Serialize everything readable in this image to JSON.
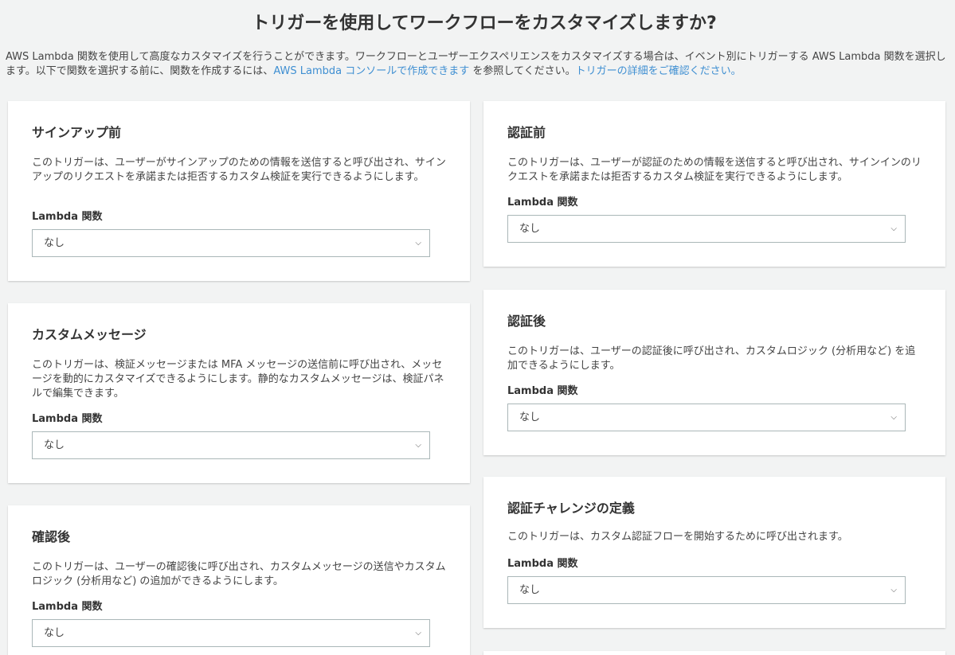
{
  "page": {
    "title": "トリガーを使用してワークフローをカスタマイズしますか?",
    "intro_text_1": "AWS Lambda 関数を使用して高度なカスタマイズを行うことができます。ワークフローとユーザーエクスペリエンスをカスタマイズする場合は、イベント別にトリガーする AWS Lambda 関数を選択します。以下で関数を選択する前に、関数を作成するには、",
    "intro_link_1": "AWS Lambda コンソールで作成できます",
    "intro_text_2": " を参照してください。",
    "intro_link_2": "トリガーの詳細をご確認ください。"
  },
  "common": {
    "lambda_label": "Lambda 関数",
    "select_value": "なし",
    "chevron_glyph": "⌵"
  },
  "triggers": {
    "pre_signup": {
      "title": "サインアップ前",
      "desc": "このトリガーは、ユーザーがサインアップのための情報を送信すると呼び出され、サインアップのリクエストを承諾または拒否するカスタム検証を実行できるようにします。"
    },
    "custom_message": {
      "title": "カスタムメッセージ",
      "desc": "このトリガーは、検証メッセージまたは MFA メッセージの送信前に呼び出され、メッセージを動的にカスタマイズできるようにします。静的なカスタムメッセージは、検証パネルで編集できます。"
    },
    "post_confirmation": {
      "title": "確認後",
      "desc": "このトリガーは、ユーザーの確認後に呼び出され、カスタムメッセージの送信やカスタムロジック (分析用など) の追加ができるようにします。"
    },
    "pre_auth": {
      "title": "認証前",
      "desc": "このトリガーは、ユーザーが認証のための情報を送信すると呼び出され、サインインのリクエストを承諾または拒否するカスタム検証を実行できるようにします。"
    },
    "post_auth": {
      "title": "認証後",
      "desc": "このトリガーは、ユーザーの認証後に呼び出され、カスタムロジック (分析用など) を追加できるようにします。"
    },
    "define_auth_challenge": {
      "title": "認証チャレンジの定義",
      "desc": "このトリガーは、カスタム認証フローを開始するために呼び出されます。"
    }
  }
}
